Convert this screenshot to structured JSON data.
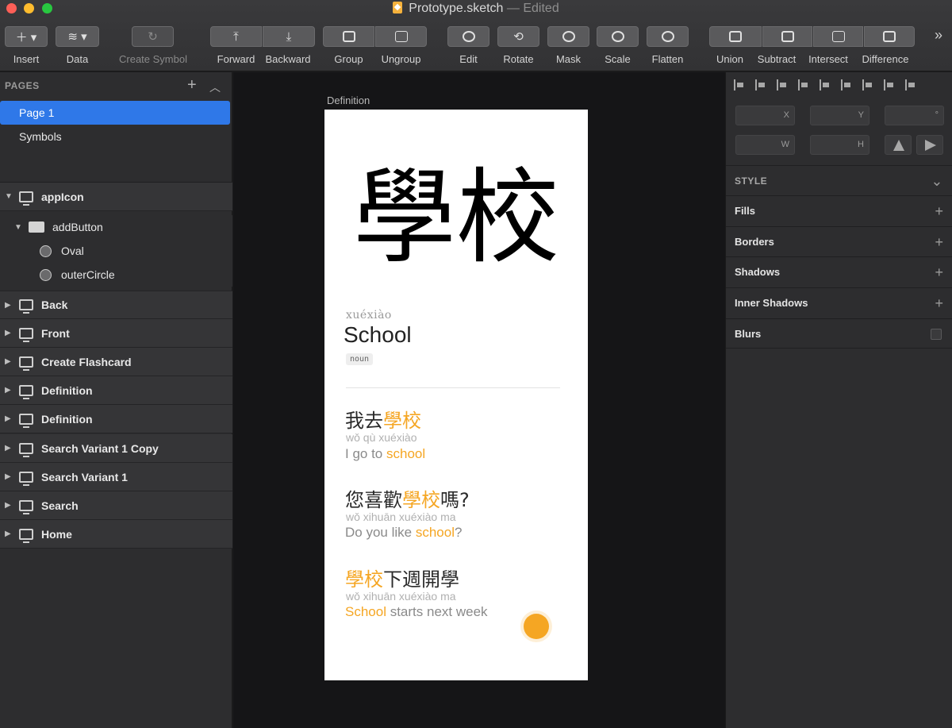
{
  "window": {
    "title": "Prototype.sketch",
    "status": "— Edited"
  },
  "toolbar": {
    "insert": "Insert",
    "data": "Data",
    "create_symbol": "Create Symbol",
    "forward": "Forward",
    "backward": "Backward",
    "group": "Group",
    "ungroup": "Ungroup",
    "edit": "Edit",
    "rotate": "Rotate",
    "mask": "Mask",
    "scale": "Scale",
    "flatten": "Flatten",
    "union": "Union",
    "subtract": "Subtract",
    "intersect": "Intersect",
    "difference": "Difference",
    "overflow": "»"
  },
  "pages": {
    "header": "PAGES",
    "items": [
      "Page 1",
      "Symbols"
    ]
  },
  "layers": {
    "appIcon": "appIcon",
    "addButton": "addButton",
    "oval": "Oval",
    "outerCircle": "outerCircle",
    "artboards": [
      "Back",
      "Front",
      "Create Flashcard",
      "Definition",
      "Definition",
      "Search Variant 1 Copy",
      "Search Variant 1",
      "Search",
      "Home"
    ]
  },
  "canvas": {
    "artboard_name": "Definition",
    "hanzi": "學校",
    "pinyin": "xuéxiào",
    "meaning": "School",
    "part_of_speech": "noun",
    "examples": [
      {
        "cn_pre": "我去",
        "cn_hl": "學校",
        "cn_post": "",
        "py": "wǒ qù xuéxiào",
        "en_pre": "I go to ",
        "en_hl": "school",
        "en_post": ""
      },
      {
        "cn_pre": "您喜歡",
        "cn_hl": "學校",
        "cn_post": "嗎?",
        "py": "wǒ xihuān xuéxiào ma",
        "en_pre": "Do you like ",
        "en_hl": "school",
        "en_post": "?"
      },
      {
        "cn_pre": "",
        "cn_hl": "學校",
        "cn_post": "下週開學",
        "py": "wǒ xihuān xuéxiào ma",
        "en_pre": "",
        "en_hl": "School",
        "en_post": " starts next week"
      }
    ]
  },
  "inspector": {
    "x_label": "X",
    "y_label": "Y",
    "rot_label": "°",
    "w_label": "W",
    "h_label": "H",
    "style_header": "STYLE",
    "fills": "Fills",
    "borders": "Borders",
    "shadows": "Shadows",
    "inner_shadows": "Inner Shadows",
    "blurs": "Blurs"
  },
  "colors": {
    "accent_orange": "#f5a623",
    "selection_blue": "#2f78e8"
  }
}
